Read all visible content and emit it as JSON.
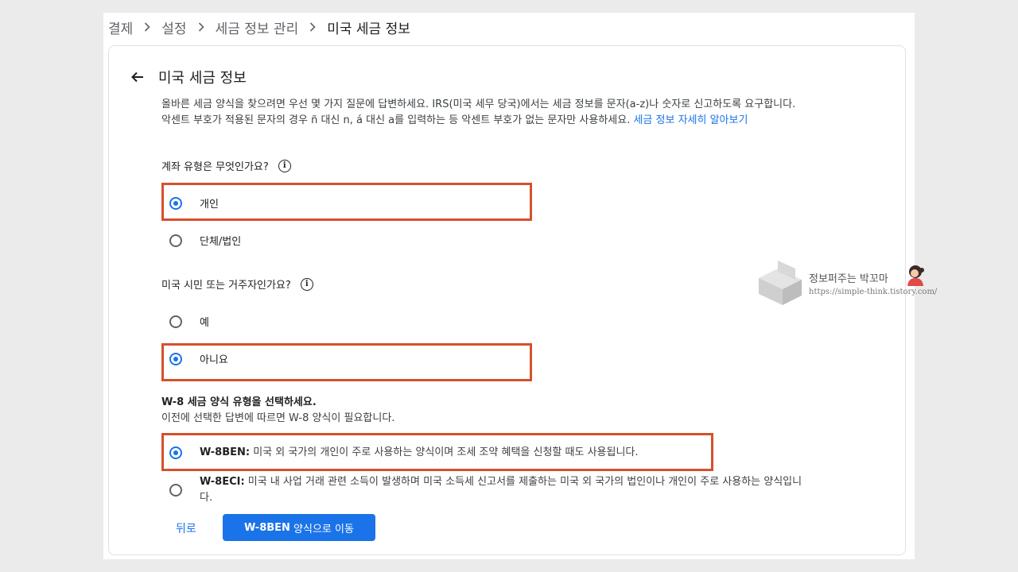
{
  "breadcrumb": {
    "items": [
      "결제",
      "설정",
      "세금 정보 관리"
    ],
    "current": "미국 세금 정보"
  },
  "header": {
    "title": "미국 세금 정보"
  },
  "intro": {
    "line1": "올바른 세금 양식을 찾으려면 우선 몇 가지 질문에 답변하세요. IRS(미국 세무 당국)에서는 세금 정보를 문자(a-z)나 숫자로 신고하도록 요구합니다.",
    "line2": "악센트 부호가 적용된 문자의 경우 ñ 대신 n, á 대신 a를 입력하는 등 악센트 부호가 없는 문자만 사용하세요.",
    "link": "세금 정보 자세히 알아보기"
  },
  "question1": {
    "label": "계좌 유형은 무엇인가요?",
    "options": [
      "개인",
      "단체/법인"
    ],
    "selected": "개인"
  },
  "question2": {
    "label": "미국 시민 또는 거주자인가요?",
    "options": [
      "예",
      "아니요"
    ],
    "selected": "아니요"
  },
  "form_section": {
    "title": "W-8 세금 양식 유형을 선택하세요.",
    "subtitle": "이전에 선택한 답변에 따르면 W-8 양식이 필요합니다.",
    "options": [
      {
        "code": "W-8BEN:",
        "desc": "미국 외 국가의 개인이 주로 사용하는 양식이며 조세 조약 혜택을 신청할 때도 사용됩니다."
      },
      {
        "code": "W-8ECI:",
        "desc": "미국 내 사업 거래 관련 소득이 발생하며 미국 소득세 신고서를 제출하는 미국 외 국가의 법인이나 개인이 주로 사용하는 양식입니",
        "desc2": "다."
      }
    ],
    "selected": "W-8BEN"
  },
  "footer": {
    "back_label": "뒤로",
    "primary_code": "W-8BEN",
    "primary_label": " 양식으로 이동"
  },
  "watermark": {
    "text": "정보퍼주는 박꼬마",
    "url": "https://simple-think.tistory.com/"
  },
  "colors": {
    "accent": "#1a73e8",
    "highlight": "#d4512c",
    "background": "#ebebeb"
  }
}
